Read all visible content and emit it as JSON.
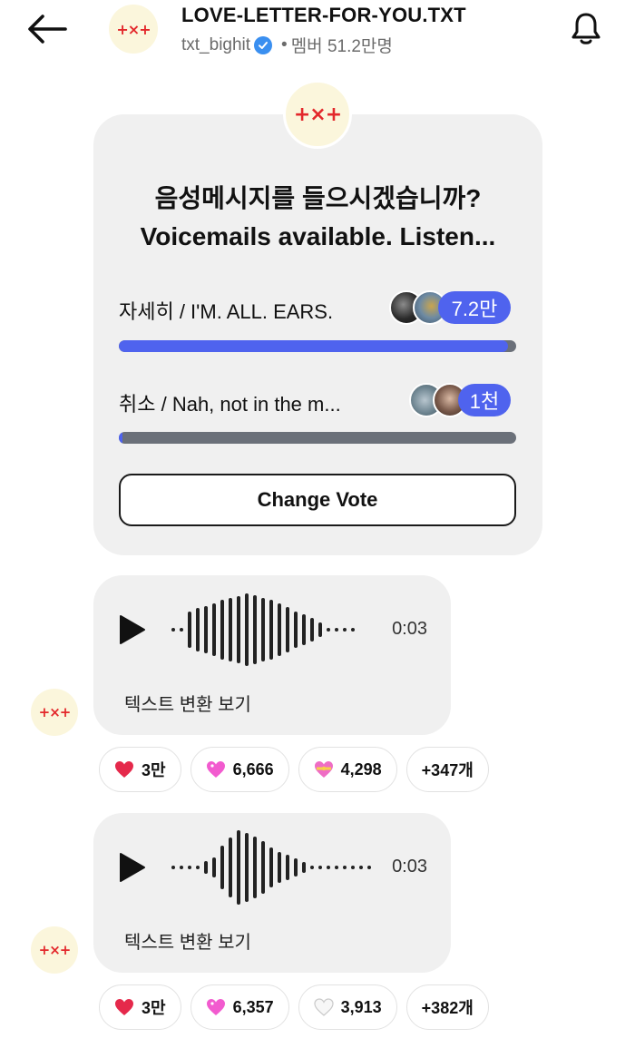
{
  "header": {
    "title": "LOVE-LETTER-FOR-YOU.TXT",
    "handle": "txt_bighit",
    "separator": "•",
    "members": "멤버 51.2만명",
    "logo_text": "+×+"
  },
  "poll": {
    "question_line1": "음성메시지를 들으시겠습니까?",
    "question_line2": "Voicemails available. Listen...",
    "options": [
      {
        "label": "자세히 / I'M. ALL. EARS.",
        "count": "7.2만",
        "share": 0.98
      },
      {
        "label": "취소 / Nah, not in the m...",
        "count": "1천",
        "share": 0.01
      }
    ],
    "change_vote_label": "Change Vote"
  },
  "messages": [
    {
      "duration": "0:03",
      "transcribe_label": "텍스트 변환 보기",
      "reactions": [
        {
          "emoji": "red-heart",
          "count": "3만"
        },
        {
          "emoji": "pink-heart",
          "count": "6,666"
        },
        {
          "emoji": "heart-ribbon",
          "count": "4,298"
        },
        {
          "emoji": "more",
          "count": "+347개"
        }
      ]
    },
    {
      "duration": "0:03",
      "transcribe_label": "텍스트 변환 보기",
      "reactions": [
        {
          "emoji": "red-heart",
          "count": "3만"
        },
        {
          "emoji": "pink-heart",
          "count": "6,357"
        },
        {
          "emoji": "white-heart",
          "count": "3,913"
        },
        {
          "emoji": "more",
          "count": "+382개"
        }
      ]
    }
  ],
  "colors": {
    "accent": "#4f63ee",
    "card_bg": "#f0f0f0",
    "logo_red": "#e3282b",
    "avatar_bg": "#fbf6dc"
  }
}
